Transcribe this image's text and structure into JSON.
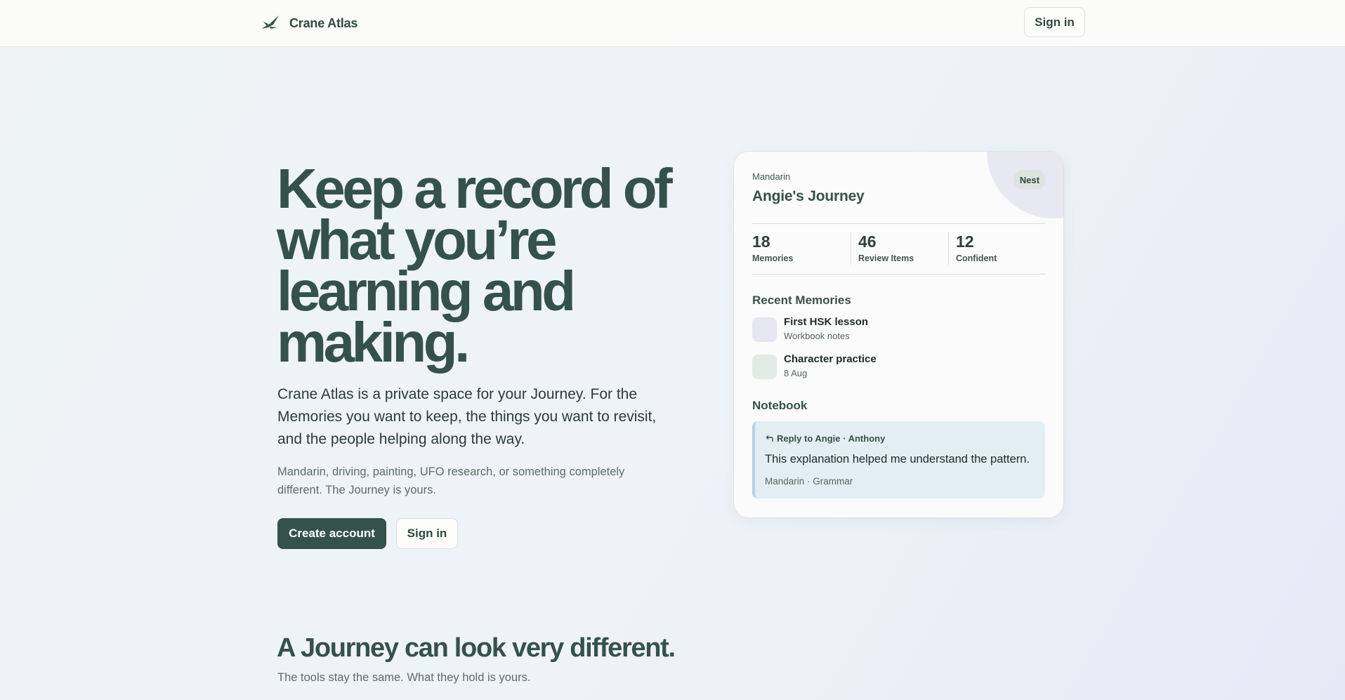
{
  "header": {
    "brand_name": "Crane Atlas",
    "brand_icon": "crane-bird-icon",
    "signin_label": "Sign in"
  },
  "hero": {
    "title": "Keep a record of what you’re learning and making.",
    "lead": "Crane Atlas is a private space for your Journey. For the Memories you want to keep, the things you want to revisit, and the people helping along the way.",
    "sub": "Mandarin, driving, painting, UFO research, or something completely different. The Journey is yours.",
    "primary_cta": "Create account",
    "secondary_cta": "Sign in"
  },
  "card": {
    "kicker": "Mandarin",
    "title": "Angie's Journey",
    "badge": "Nest",
    "stats": [
      {
        "value": "18",
        "label": "Memories"
      },
      {
        "value": "46",
        "label": "Review Items"
      },
      {
        "value": "12",
        "label": "Confident"
      }
    ],
    "recent_heading": "Recent Memories",
    "memories": [
      {
        "title": "First HSK lesson",
        "meta": "Workbook notes",
        "color": "#e6e6f1"
      },
      {
        "title": "Character practice",
        "meta": "8 Aug",
        "color": "#e2ebe5"
      }
    ],
    "notebook_heading": "Notebook",
    "note": {
      "reply_icon": "reply-arrow-icon",
      "head": "Reply to Angie · Anthony",
      "body": "This explanation helped me understand the pattern.",
      "meta": "Mandarin · Grammar"
    }
  },
  "lower": {
    "title": "A Journey can look very different.",
    "sub": "The tools stay the same. What they hold is yours."
  },
  "colors": {
    "accent": "#35524a",
    "note_bg": "#e3eef4",
    "note_border": "#b6d0e0"
  }
}
